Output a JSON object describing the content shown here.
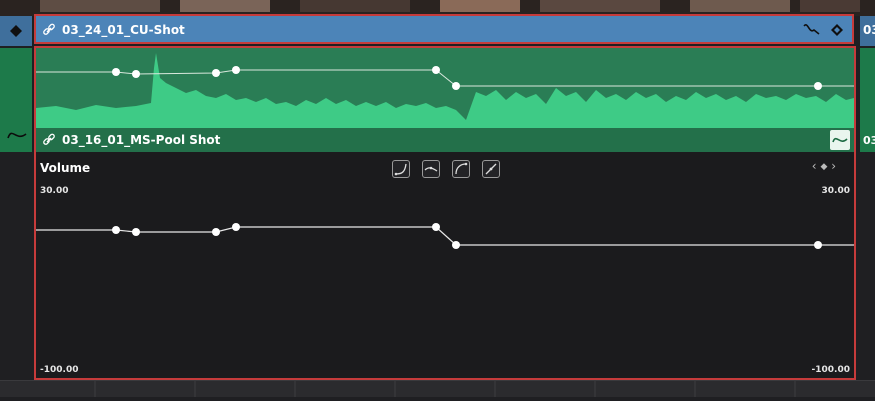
{
  "video_clip": {
    "title": "03_24_01_CU-Shot",
    "next_clip_label": "03"
  },
  "audio_clip": {
    "title": "03_16_01_MS-Pool Shot",
    "next_clip_label": "03"
  },
  "volume_editor": {
    "label": "Volume",
    "max_left": "30.00",
    "max_right": "30.00",
    "min_left": "-100.00",
    "min_right": "-100.00",
    "curve_buttons": [
      "ease-in-curve-icon",
      "ease-out-curve-icon",
      "ease-in-out-curve-icon",
      "linear-curve-icon"
    ],
    "keyframe_nav": [
      "keyframe-prev-icon",
      "keyframe-add-icon",
      "keyframe-next-icon"
    ]
  },
  "colors": {
    "video_clip": "#4c84b8",
    "audio_clip": "#2a7d55",
    "waveform": "#3ecb86",
    "selection_border": "#c63b3b",
    "panel_bg": "#1b1b1d"
  }
}
